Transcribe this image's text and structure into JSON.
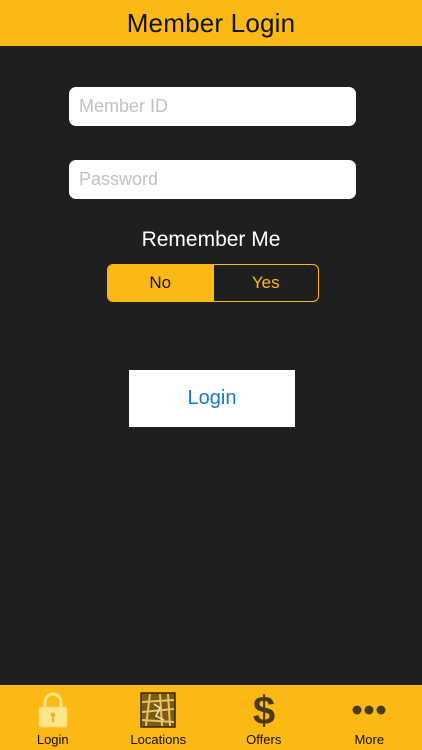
{
  "header": {
    "title": "Member Login"
  },
  "form": {
    "member_id_placeholder": "Member ID",
    "member_id_value": "",
    "password_placeholder": "Password",
    "password_value": "",
    "remember_label": "Remember Me",
    "remember_options": [
      "No",
      "Yes"
    ],
    "remember_selected": "No",
    "login_label": "Login"
  },
  "tabbar": {
    "items": [
      {
        "label": "Login",
        "icon": "lock-icon"
      },
      {
        "label": "Locations",
        "icon": "map-icon"
      },
      {
        "label": "Offers",
        "icon": "dollar-icon"
      },
      {
        "label": "More",
        "icon": "more-dots-icon"
      }
    ]
  },
  "colors": {
    "accent": "#fdb913",
    "background": "#1f1f20",
    "link": "#1477d6"
  }
}
